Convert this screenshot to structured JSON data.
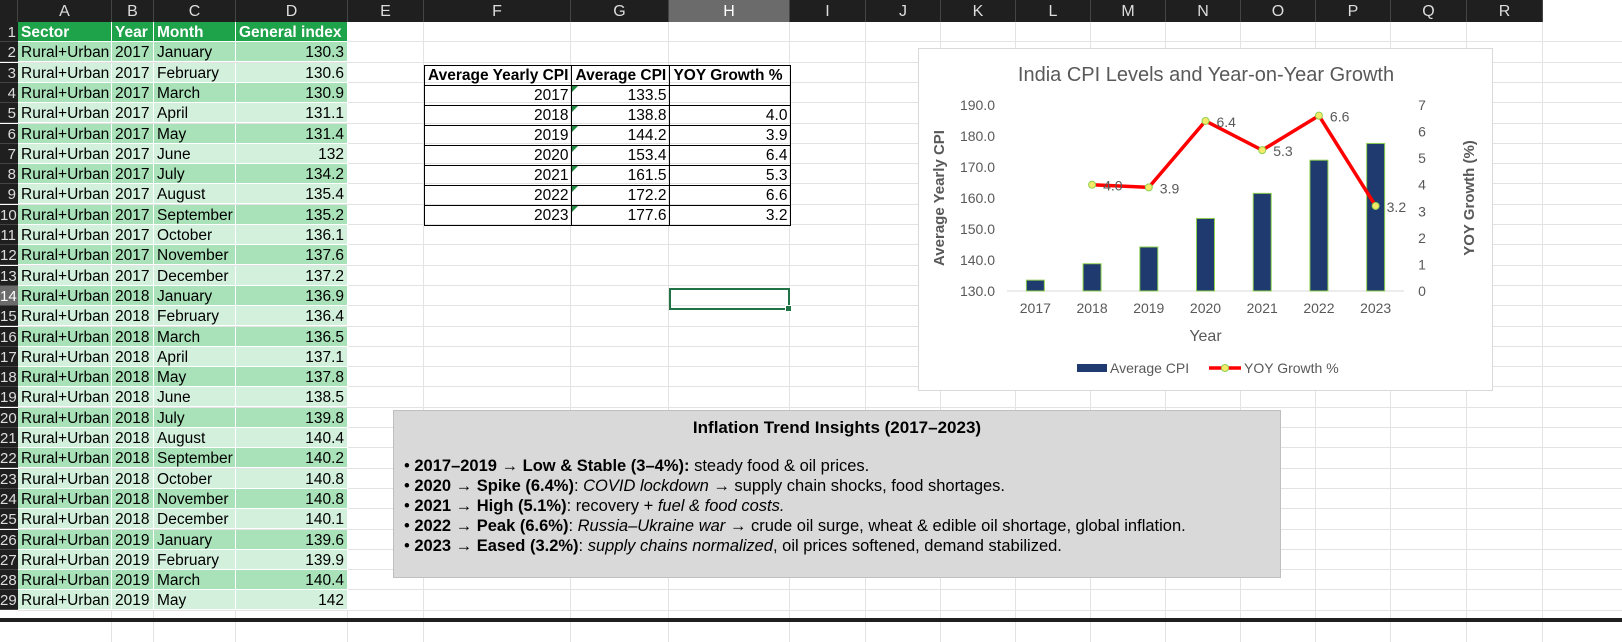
{
  "columns": [
    "A",
    "B",
    "C",
    "D",
    "E",
    "F",
    "G",
    "H",
    "I",
    "J",
    "K",
    "L",
    "M",
    "N",
    "O",
    "P",
    "Q",
    "R"
  ],
  "row_numbers": [
    "1",
    "2",
    "3",
    "4",
    "5",
    "6",
    "7",
    "8",
    "9",
    "10",
    "11",
    "12",
    "13",
    "14",
    "15",
    "16",
    "17",
    "18",
    "19",
    "20",
    "21",
    "22",
    "23",
    "24",
    "25",
    "26",
    "27",
    "28",
    "29"
  ],
  "selected_column": "H",
  "selected_row": "14",
  "data_table": {
    "headers": [
      "Sector",
      "Year",
      "Month",
      "General index"
    ],
    "rows": [
      [
        "Rural+Urban",
        "2017",
        "January",
        "130.3"
      ],
      [
        "Rural+Urban",
        "2017",
        "February",
        "130.6"
      ],
      [
        "Rural+Urban",
        "2017",
        "March",
        "130.9"
      ],
      [
        "Rural+Urban",
        "2017",
        "April",
        "131.1"
      ],
      [
        "Rural+Urban",
        "2017",
        "May",
        "131.4"
      ],
      [
        "Rural+Urban",
        "2017",
        "June",
        "132"
      ],
      [
        "Rural+Urban",
        "2017",
        "July",
        "134.2"
      ],
      [
        "Rural+Urban",
        "2017",
        "August",
        "135.4"
      ],
      [
        "Rural+Urban",
        "2017",
        "September",
        "135.2"
      ],
      [
        "Rural+Urban",
        "2017",
        "October",
        "136.1"
      ],
      [
        "Rural+Urban",
        "2017",
        "November",
        "137.6"
      ],
      [
        "Rural+Urban",
        "2017",
        "December",
        "137.2"
      ],
      [
        "Rural+Urban",
        "2018",
        "January",
        "136.9"
      ],
      [
        "Rural+Urban",
        "2018",
        "February",
        "136.4"
      ],
      [
        "Rural+Urban",
        "2018",
        "March",
        "136.5"
      ],
      [
        "Rural+Urban",
        "2018",
        "April",
        "137.1"
      ],
      [
        "Rural+Urban",
        "2018",
        "May",
        "137.8"
      ],
      [
        "Rural+Urban",
        "2018",
        "June",
        "138.5"
      ],
      [
        "Rural+Urban",
        "2018",
        "July",
        "139.8"
      ],
      [
        "Rural+Urban",
        "2018",
        "August",
        "140.4"
      ],
      [
        "Rural+Urban",
        "2018",
        "September",
        "140.2"
      ],
      [
        "Rural+Urban",
        "2018",
        "October",
        "140.8"
      ],
      [
        "Rural+Urban",
        "2018",
        "November",
        "140.8"
      ],
      [
        "Rural+Urban",
        "2018",
        "December",
        "140.1"
      ],
      [
        "Rural+Urban",
        "2019",
        "January",
        "139.6"
      ],
      [
        "Rural+Urban",
        "2019",
        "February",
        "139.9"
      ],
      [
        "Rural+Urban",
        "2019",
        "March",
        "140.4"
      ],
      [
        "Rural+Urban",
        "2019",
        "May",
        "142"
      ]
    ]
  },
  "summary_table": {
    "headers": [
      "Average Yearly CPI",
      "Average CPI",
      "YOY Growth %"
    ],
    "rows": [
      [
        "2017",
        "133.5",
        ""
      ],
      [
        "2018",
        "138.8",
        "4.0"
      ],
      [
        "2019",
        "144.2",
        "3.9"
      ],
      [
        "2020",
        "153.4",
        "6.4"
      ],
      [
        "2021",
        "161.5",
        "5.3"
      ],
      [
        "2022",
        "172.2",
        "6.6"
      ],
      [
        "2023",
        "177.6",
        "3.2"
      ]
    ]
  },
  "chart_data": {
    "type": "bar",
    "title": "India CPI Levels and Year-on-Year Growth",
    "xlabel": "Year",
    "ylabel": "Average Yearly CPI",
    "y2label": "YOY Growth (%)",
    "categories": [
      "2017",
      "2018",
      "2019",
      "2020",
      "2021",
      "2022",
      "2023"
    ],
    "ylim": [
      130,
      190
    ],
    "y_ticks": [
      "130.0",
      "140.0",
      "150.0",
      "160.0",
      "170.0",
      "180.0",
      "190.0"
    ],
    "y2lim": [
      0,
      7
    ],
    "y2_ticks": [
      "0",
      "1",
      "2",
      "3",
      "4",
      "5",
      "6",
      "7"
    ],
    "series": [
      {
        "name": "Average CPI",
        "type": "bar",
        "color": "#1f3a6e",
        "values": [
          133.5,
          138.8,
          144.2,
          153.4,
          161.5,
          172.2,
          177.6
        ]
      },
      {
        "name": "YOY Growth %",
        "type": "line",
        "axis": "secondary",
        "color": "#ff0000",
        "values": [
          null,
          4.0,
          3.9,
          6.4,
          5.3,
          6.6,
          3.2
        ],
        "labels": [
          "",
          "4.0",
          "3.9",
          "6.4",
          "5.3",
          "6.6",
          "3.2"
        ]
      }
    ],
    "legend": "bottom",
    "grid": false
  },
  "insights": {
    "title": "Inflation Trend Insights (2017–2023)",
    "lines": [
      [
        {
          "t": "• ",
          "s": "n"
        },
        {
          "t": "2017–2019 → Low & Stable (3–4%):",
          "s": "b"
        },
        {
          "t": " steady food & oil prices.",
          "s": "n"
        }
      ],
      [
        {
          "t": "• ",
          "s": "n"
        },
        {
          "t": "2020 → Spike (6.4%)",
          "s": "b"
        },
        {
          "t": ": ",
          "s": "n"
        },
        {
          "t": "COVID lockdown",
          "s": "i"
        },
        {
          "t": " → supply chain shocks, food shortages.",
          "s": "n"
        }
      ],
      [
        {
          "t": "• ",
          "s": "n"
        },
        {
          "t": "2021 → High (5.1%)",
          "s": "b"
        },
        {
          "t": ": recovery + ",
          "s": "n"
        },
        {
          "t": "fuel & food costs.",
          "s": "i"
        }
      ],
      [
        {
          "t": "• ",
          "s": "n"
        },
        {
          "t": "2022 → Peak (6.6%)",
          "s": "b"
        },
        {
          "t": ": ",
          "s": "n"
        },
        {
          "t": "Russia–Ukraine war",
          "s": "i"
        },
        {
          "t": " → crude oil surge, wheat & edible oil shortage, global inflation.",
          "s": "n"
        }
      ],
      [
        {
          "t": "• ",
          "s": "n"
        },
        {
          "t": "2023 → Eased (3.2%)",
          "s": "b"
        },
        {
          "t": ": ",
          "s": "n"
        },
        {
          "t": "supply chains normalized",
          "s": "i"
        },
        {
          "t": ", oil prices softened, demand stabilized.",
          "s": "n"
        }
      ]
    ]
  }
}
